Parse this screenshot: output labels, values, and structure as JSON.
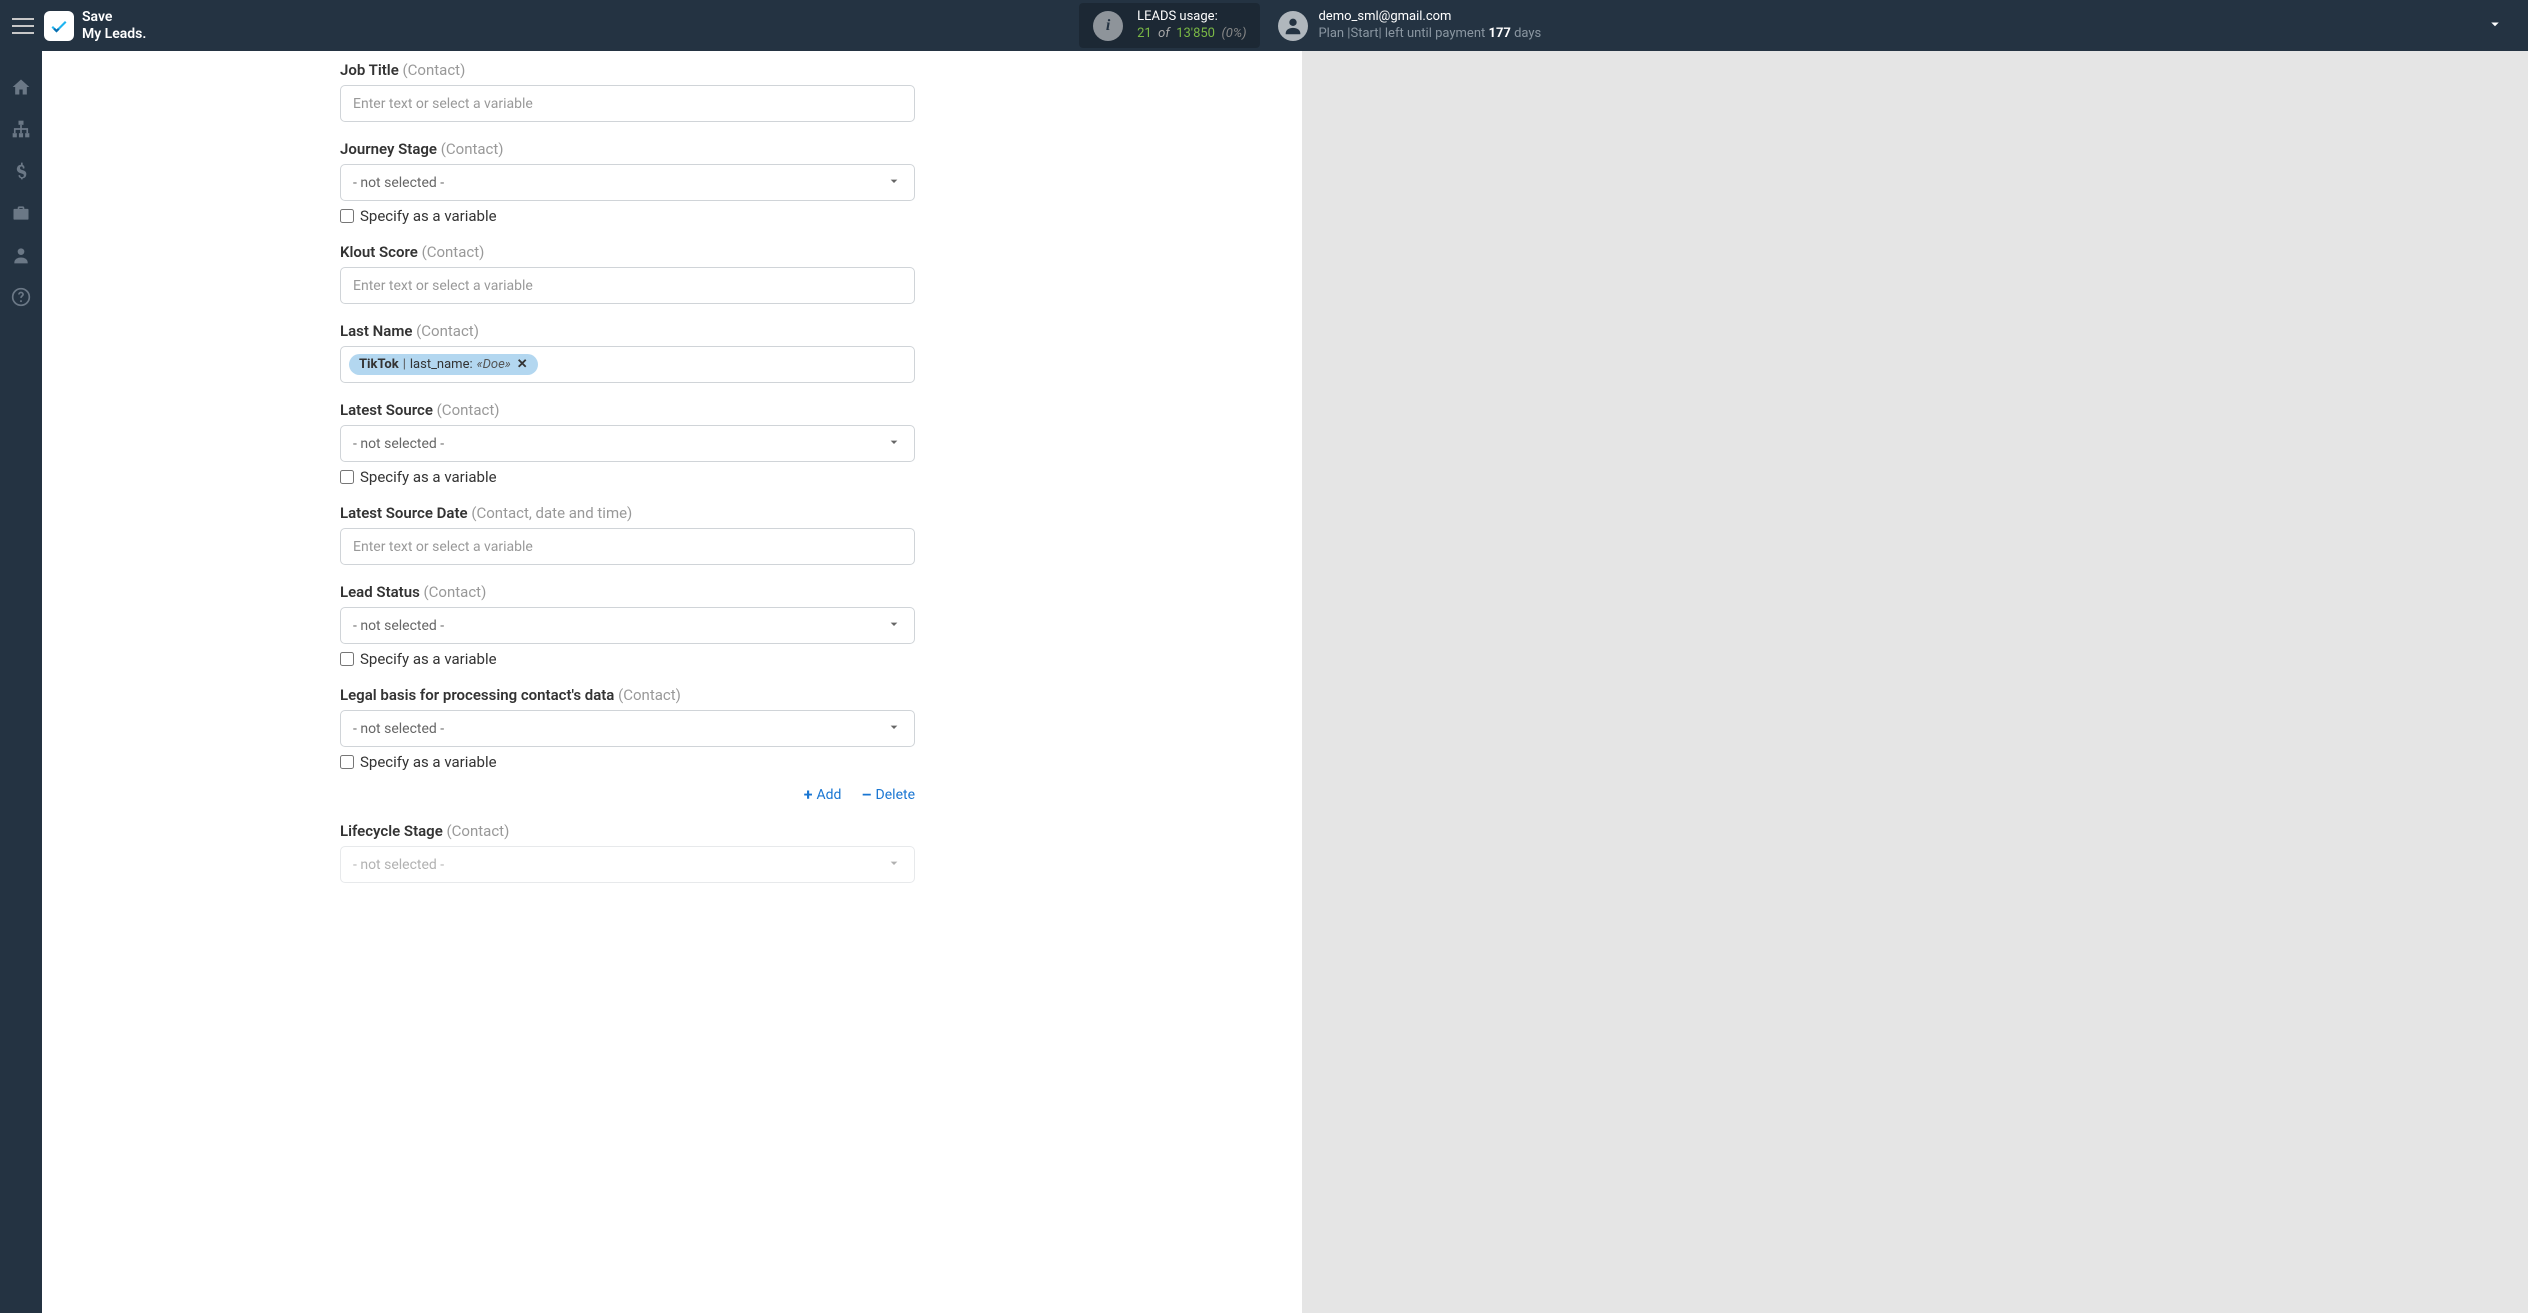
{
  "header": {
    "logo_line1": "Save",
    "logo_line2": "My Leads.",
    "usage_label": "LEADS usage:",
    "usage_used": "21",
    "usage_of": "of",
    "usage_total": "13'850",
    "usage_pct": "(0%)",
    "user_email": "demo_sml@gmail.com",
    "user_plan_prefix": "Plan |Start| left until payment ",
    "user_plan_days": "177",
    "user_plan_suffix": " days"
  },
  "sidebar": {
    "items": [
      {
        "name": "home"
      },
      {
        "name": "sitemap"
      },
      {
        "name": "dollar"
      },
      {
        "name": "briefcase"
      },
      {
        "name": "user"
      },
      {
        "name": "help"
      }
    ]
  },
  "form": {
    "placeholder_text": "Enter text or select a variable",
    "not_selected": "- not selected -",
    "specify_variable": "Specify as a variable",
    "add_label": "Add",
    "delete_label": "Delete",
    "fields": {
      "job_title": {
        "label": "Job Title",
        "hint": "(Contact)"
      },
      "journey_stage": {
        "label": "Journey Stage",
        "hint": "(Contact)"
      },
      "klout_score": {
        "label": "Klout Score",
        "hint": "(Contact)"
      },
      "last_name": {
        "label": "Last Name",
        "hint": "(Contact)",
        "chip": {
          "source": "TikTok",
          "sep": " | ",
          "field": "last_name: ",
          "example": "«Doe»"
        }
      },
      "latest_source": {
        "label": "Latest Source",
        "hint": "(Contact)"
      },
      "latest_source_date": {
        "label": "Latest Source Date",
        "hint": "(Contact, date and time)"
      },
      "lead_status": {
        "label": "Lead Status",
        "hint": "(Contact)"
      },
      "legal_basis": {
        "label": "Legal basis for processing contact's data",
        "hint": "(Contact)"
      },
      "lifecycle_stage": {
        "label": "Lifecycle Stage",
        "hint": "(Contact)"
      }
    }
  }
}
